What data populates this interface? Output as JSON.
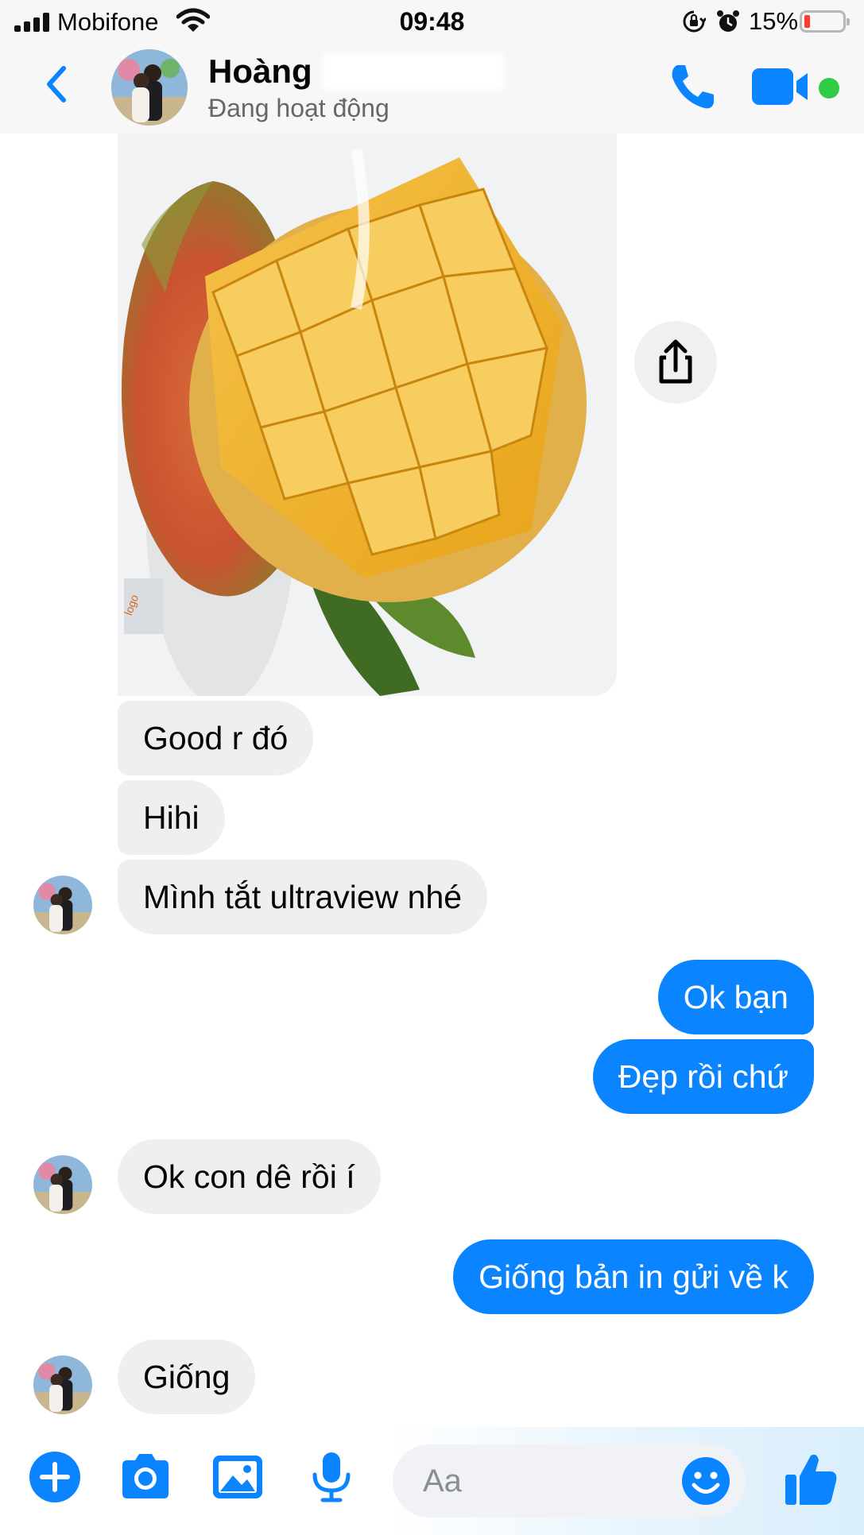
{
  "status_bar": {
    "carrier": "Mobifone",
    "time": "09:48",
    "battery_percent": "15%"
  },
  "header": {
    "contact_name": "Hoàng",
    "contact_status": "Đang hoạt động",
    "online_color": "#31cc46"
  },
  "icons": {
    "back": "chevron-left-icon",
    "call": "phone-icon",
    "video": "video-camera-icon",
    "share": "share-icon",
    "add": "plus-circle-icon",
    "camera": "camera-icon",
    "gallery": "image-icon",
    "mic": "microphone-icon",
    "emoji": "smiley-icon",
    "like": "thumbs-up-icon"
  },
  "messages": [
    {
      "from": "contact",
      "text": "Good r đó"
    },
    {
      "from": "contact",
      "text": "Hihi"
    },
    {
      "from": "contact",
      "text": "Mình tắt ultraview nhé"
    },
    {
      "from": "me",
      "text": "Ok bạn"
    },
    {
      "from": "me",
      "text": "Đẹp rồi chứ"
    },
    {
      "from": "contact",
      "text": "Ok con dê rồi í"
    },
    {
      "from": "me",
      "text": "Giống bản in gửi về k"
    },
    {
      "from": "contact",
      "text": "Giống"
    }
  ],
  "composer": {
    "placeholder": "Aa"
  },
  "colors": {
    "accent": "#0a84ff",
    "incoming_bubble": "#efefef"
  }
}
